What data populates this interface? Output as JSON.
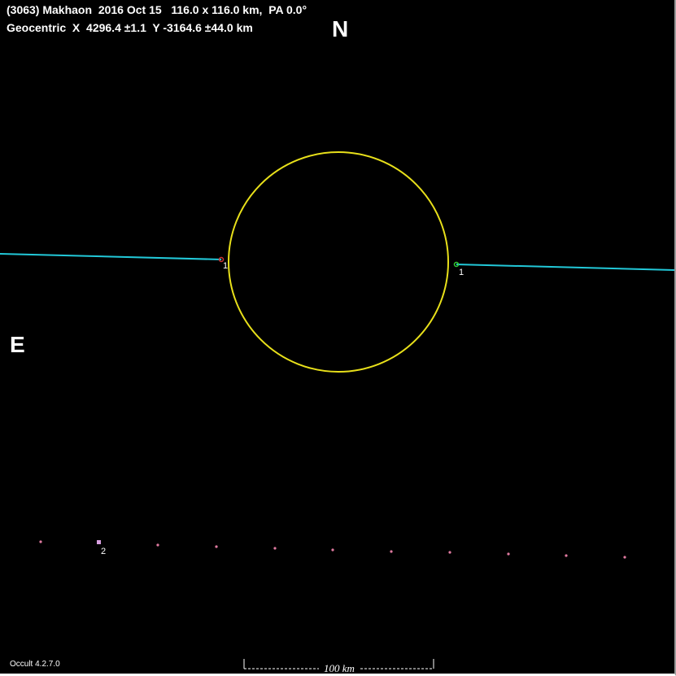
{
  "header": {
    "line1": "(3063) Makhaon  2016 Oct 15   116.0 x 116.0 km,  PA 0.0°",
    "line2": "Geocentric  X  4296.4 ±1.1  Y -3164.6 ±44.0 km"
  },
  "compass": {
    "north": "N",
    "east": "E"
  },
  "asteroid_outline": {
    "color": "#e8e01a"
  },
  "chords": [
    {
      "label": "1",
      "color": "#22c8d8",
      "start_marker_color": "#cc3333",
      "end_marker_color": "#33cc33"
    }
  ],
  "miss_chord": {
    "label": "2",
    "color": "#e07aa0",
    "marker_color": "#d8a0e0"
  },
  "scale_bar": {
    "label": "100 km"
  },
  "footer": {
    "version": "Occult 4.2.7.0"
  }
}
